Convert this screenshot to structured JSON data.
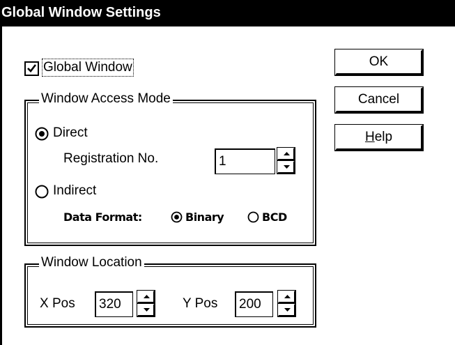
{
  "window": {
    "title": "Global Window Settings"
  },
  "global_window": {
    "label": "Global Window",
    "checked": true
  },
  "access_mode": {
    "legend": "Window Access Mode",
    "direct_label": "Direct",
    "registration_label": "Registration No.",
    "registration_value": "1",
    "indirect_label": "Indirect",
    "data_format_label": "Data Format:",
    "binary_label": "Binary",
    "bcd_label": "BCD",
    "selected_mode": "Direct",
    "selected_format": "Binary"
  },
  "location": {
    "legend": "Window Location",
    "x_label": "X Pos",
    "x_value": "320",
    "y_label": "Y Pos",
    "y_value": "200"
  },
  "buttons": {
    "ok": "OK",
    "cancel": "Cancel",
    "help_prefix": "H",
    "help_rest": "elp"
  }
}
